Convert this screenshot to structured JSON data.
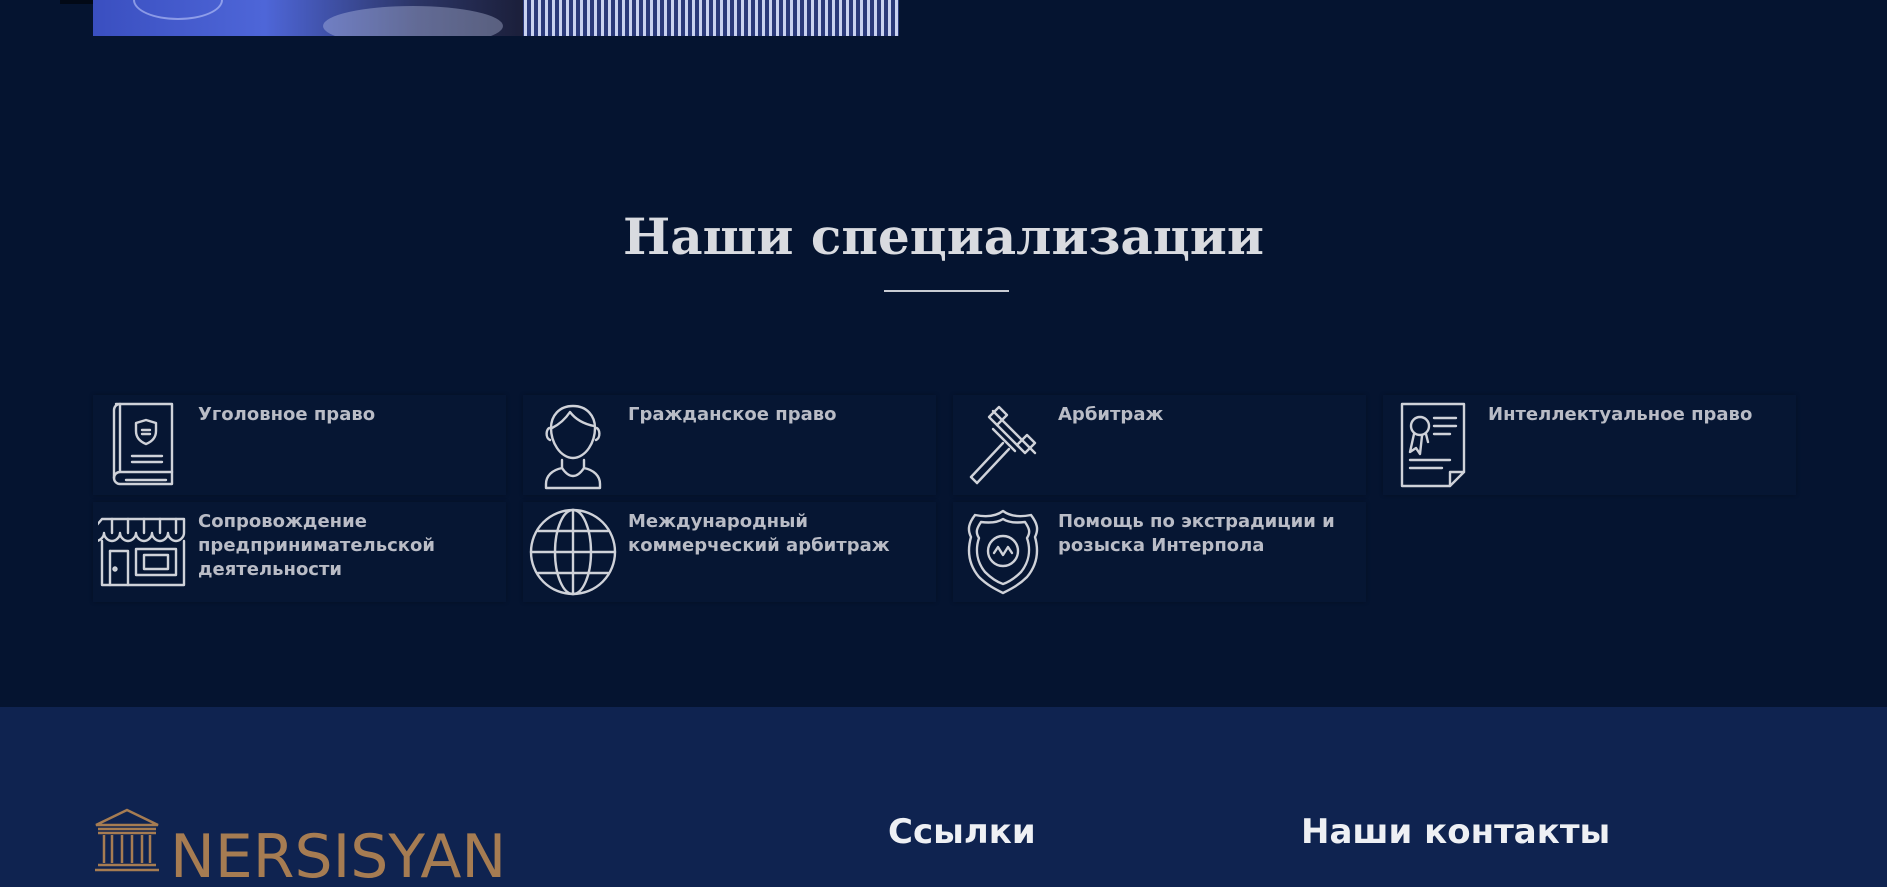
{
  "hero_image": {
    "alt": "lawyer-photo"
  },
  "specializations": {
    "title": "Наши специализации",
    "items": [
      {
        "label": "Уголовное право",
        "icon": "law-book-icon"
      },
      {
        "label": "Гражданское право",
        "icon": "person-icon"
      },
      {
        "label": "Арбитраж",
        "icon": "gavel-icon"
      },
      {
        "label": "Интеллектуальное право",
        "icon": "certificate-icon"
      },
      {
        "label": "Сопровождение предпринимательской деятельности",
        "icon": "storefront-icon"
      },
      {
        "label": "Международный коммерческий арбитраж",
        "icon": "globe-icon"
      },
      {
        "label": "Помощь по экстрадиции и розыска Интерпола",
        "icon": "police-badge-icon"
      }
    ]
  },
  "footer": {
    "logo_text": "NERSISYAN",
    "links_heading": "Ссылки",
    "contacts_heading": "Наши контакты"
  },
  "colors": {
    "background": "#051430",
    "footer_background": "#0f2350",
    "brand_gold": "#a67c52",
    "text_light": "#d9dbe0"
  }
}
